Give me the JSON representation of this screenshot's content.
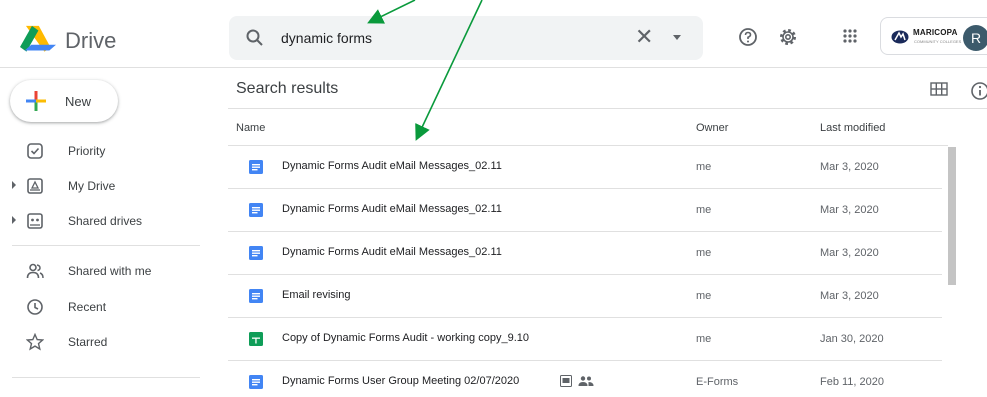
{
  "app": {
    "name": "Drive"
  },
  "search": {
    "query": "dynamic forms"
  },
  "account": {
    "org_name": "MARICOPA",
    "org_sub": "COMMUNITY COLLEGES",
    "avatar_letter": "R"
  },
  "sidebar": {
    "new_label": "New",
    "items": [
      {
        "label": "Priority",
        "icon": "priority-icon"
      },
      {
        "label": "My Drive",
        "icon": "my-drive-icon",
        "expandable": true
      },
      {
        "label": "Shared drives",
        "icon": "shared-drives-icon",
        "expandable": true
      },
      {
        "label": "Shared with me",
        "icon": "shared-with-me-icon"
      },
      {
        "label": "Recent",
        "icon": "clock-icon"
      },
      {
        "label": "Starred",
        "icon": "star-icon"
      }
    ]
  },
  "results": {
    "title": "Search results",
    "columns": {
      "name": "Name",
      "owner": "Owner",
      "modified": "Last modified"
    },
    "rows": [
      {
        "name": "Dynamic Forms Audit eMail Messages_02.11",
        "owner": "me",
        "modified": "Mar 3, 2020",
        "type": "doc"
      },
      {
        "name": "Dynamic Forms Audit eMail Messages_02.11",
        "owner": "me",
        "modified": "Mar 3, 2020",
        "type": "doc"
      },
      {
        "name": "Dynamic Forms Audit eMail Messages_02.11",
        "owner": "me",
        "modified": "Mar 3, 2020",
        "type": "doc"
      },
      {
        "name": "Email revising",
        "owner": "me",
        "modified": "Mar 3, 2020",
        "type": "doc"
      },
      {
        "name": "Copy of Dynamic Forms Audit - working copy_9.10",
        "owner": "me",
        "modified": "Jan 30, 2020",
        "type": "sheet"
      },
      {
        "name": "Dynamic Forms User Group Meeting 02/07/2020",
        "owner": "E-Forms",
        "modified": "Feb 11, 2020",
        "type": "doc",
        "badges": [
          "slides-icon",
          "shared-icon"
        ]
      }
    ]
  },
  "colors": {
    "doc": "#4285f4",
    "sheet": "#0f9d58",
    "annotation_arrow": "#0a9a3c"
  }
}
